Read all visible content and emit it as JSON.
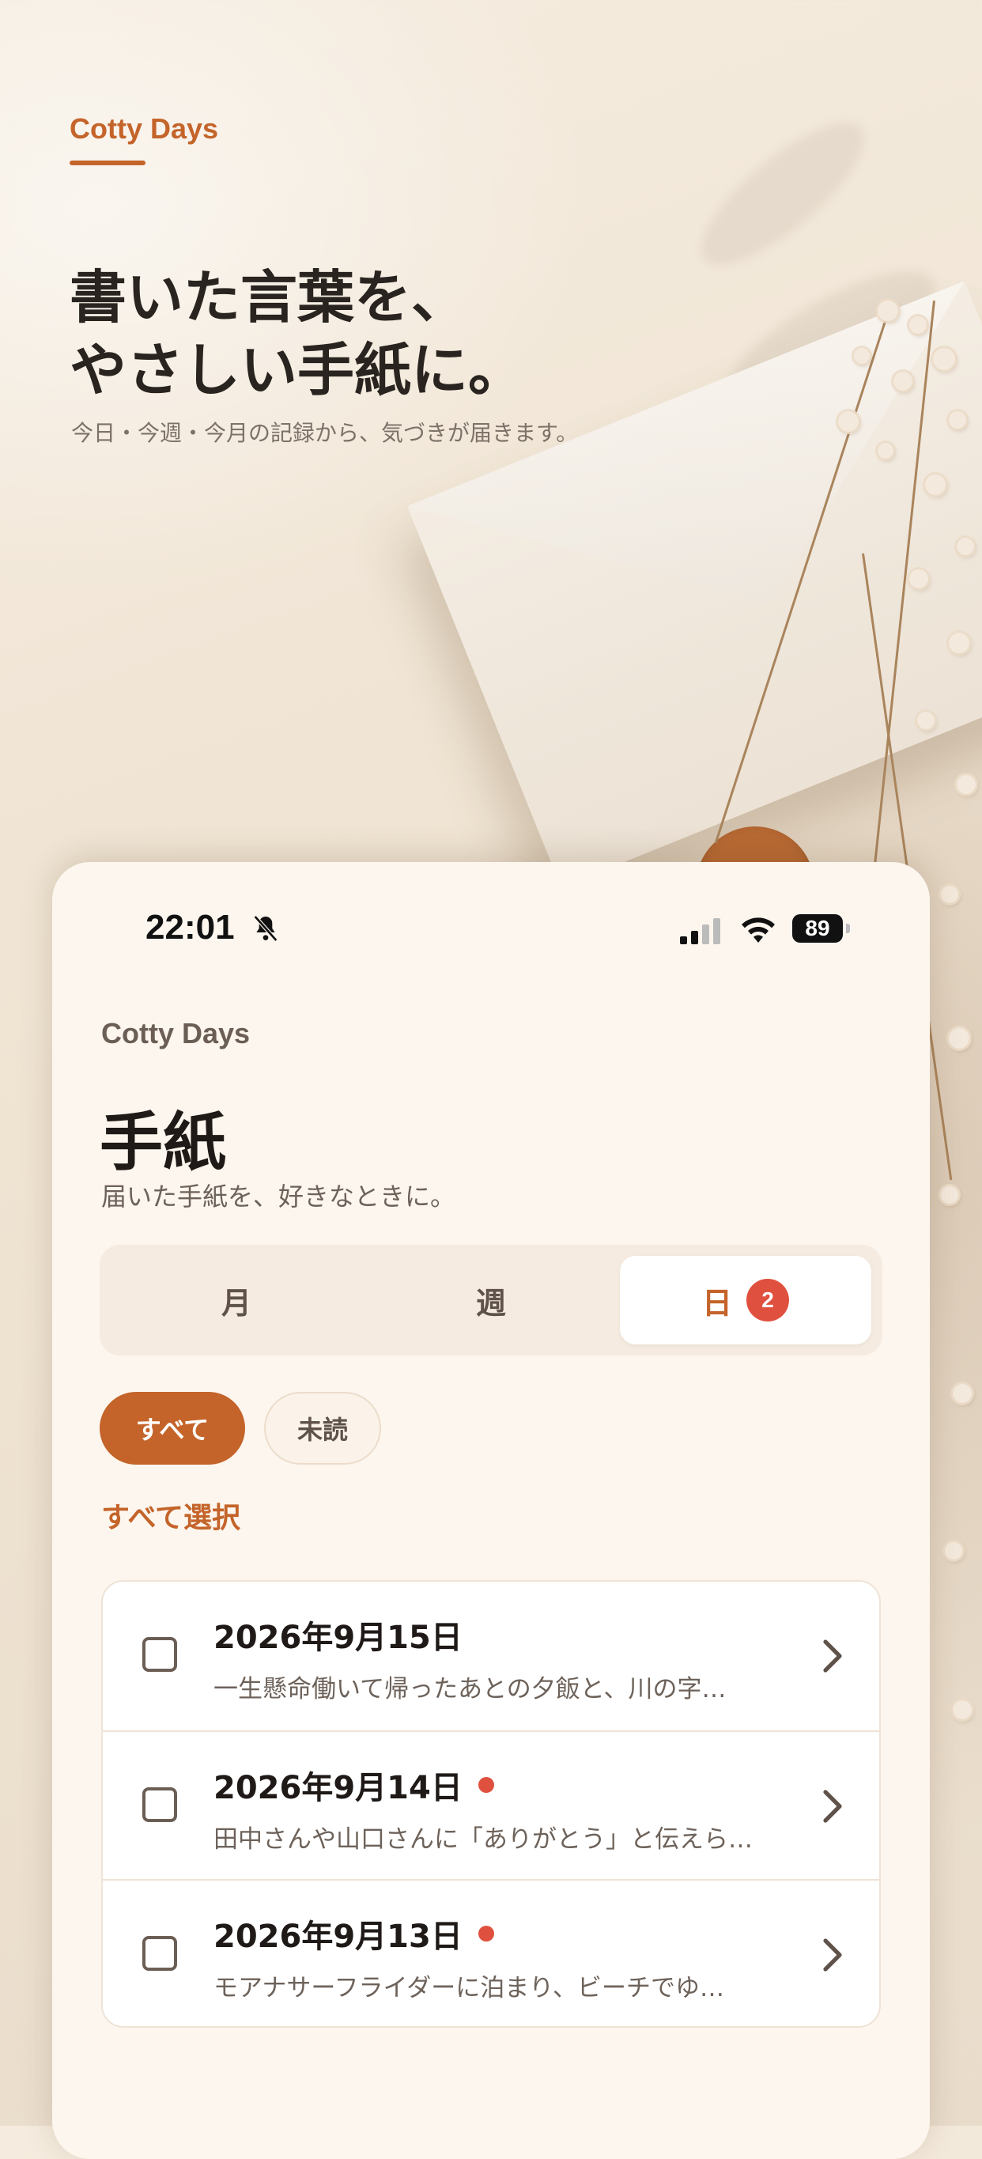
{
  "hero": {
    "brand": "Cotty Days",
    "title": "書いた言葉を、\nやさしい手紙に。",
    "subtitle": "今日・今週・今月の記録から、気づきが届きます。"
  },
  "status_bar": {
    "time": "22:01",
    "battery": "89",
    "icons": [
      "bell-off-icon",
      "signal-icon",
      "wifi-icon",
      "battery-icon"
    ]
  },
  "app": {
    "brand": "Cotty Days",
    "title": "手紙",
    "subtitle": "届いた手紙を、好きなときに。"
  },
  "segments": [
    {
      "label": "月",
      "active": false
    },
    {
      "label": "週",
      "active": false
    },
    {
      "label": "日",
      "active": true,
      "badge": "2"
    }
  ],
  "filters": {
    "all": "すべて",
    "unread": "未読"
  },
  "select_all": "すべて選択",
  "letters": [
    {
      "date": "2026年9月15日",
      "preview": "一生懸命働いて帰ったあとの夕飯と、川の字…",
      "unread": false
    },
    {
      "date": "2026年9月14日",
      "preview": "田中さんや山口さんに「ありがとう」と伝えら…",
      "unread": true
    },
    {
      "date": "2026年9月13日",
      "preview": "モアナサーフライダーに泊まり、ビーチでゆ…",
      "unread": true
    }
  ],
  "colors": {
    "accent": "#c4642a",
    "badge": "#e0503f",
    "card_bg": "#fdf6ee"
  }
}
